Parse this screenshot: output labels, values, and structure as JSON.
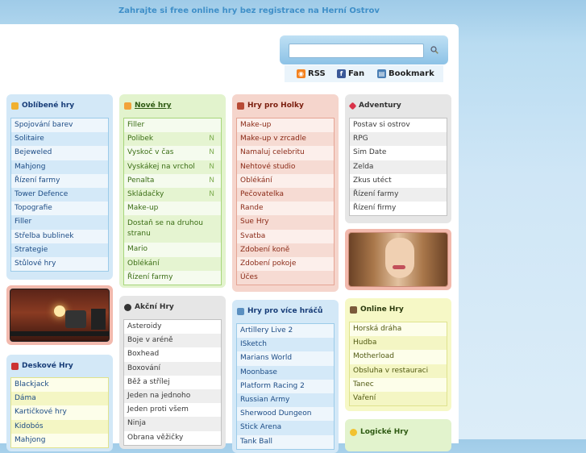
{
  "header": {
    "tagline": "Zahrajte si free online hry bez registrace na Herní Ostrov"
  },
  "search": {
    "placeholder": "",
    "button_icon": "magnifier-icon"
  },
  "links": [
    {
      "label": "RSS",
      "icon": "rss-icon",
      "color": "#f4821f"
    },
    {
      "label": "Fan",
      "icon": "facebook-icon",
      "color": "#3b5998"
    },
    {
      "label": "Bookmark",
      "icon": "bookmark-icon",
      "color": "#4a7fb5"
    }
  ],
  "categories": {
    "oblibene": {
      "title": "Oblíbené hry",
      "items": [
        "Spojování barev",
        "Solitaire",
        "Bejeweled",
        "Mahjong",
        "Řízení farmy",
        "Tower Defence",
        "Topografie",
        "Filler",
        "Střelba bublinek",
        "Strategie",
        "Stůlové hry"
      ]
    },
    "nove": {
      "title": "Nové hry",
      "items": [
        {
          "label": "Filler",
          "badge": ""
        },
        {
          "label": "Polibek",
          "badge": "N"
        },
        {
          "label": "Vyskoč v čas",
          "badge": "N"
        },
        {
          "label": "Vyskákej na vrchol",
          "badge": "N"
        },
        {
          "label": "Penalta",
          "badge": "N"
        },
        {
          "label": "Skládačky",
          "badge": "N"
        },
        {
          "label": "Make-up",
          "badge": ""
        },
        {
          "label": "Dostaň se na druhou stranu",
          "badge": ""
        },
        {
          "label": "Mario",
          "badge": ""
        },
        {
          "label": "Oblékání",
          "badge": ""
        },
        {
          "label": "Řízení farmy",
          "badge": ""
        }
      ]
    },
    "holky": {
      "title": "Hry pro Holky",
      "items": [
        "Make-up",
        "Make-up v zrcadle",
        "Namaluj celebritu",
        "Nehtové studio",
        "Oblékání",
        "Pečovatelka",
        "Rande",
        "Sue Hry",
        "Svatba",
        "Zdobení koně",
        "Zdobení pokoje",
        "Účes"
      ]
    },
    "adventury": {
      "title": "Adventury",
      "items": [
        "Postav si ostrov",
        "RPG",
        "Sim Date",
        "Zelda",
        "Zkus utéct",
        "Řízení farmy",
        "Řízení firmy"
      ]
    },
    "deskove": {
      "title": "Deskové Hry",
      "items": [
        "Blackjack",
        "Dáma",
        "Kartičkové hry",
        "Kidobós",
        "Mahjong"
      ]
    },
    "akcni": {
      "title": "Akční Hry",
      "items": [
        "Asteroidy",
        "Boje v aréně",
        "Boxhead",
        "Boxování",
        "Běž a střílej",
        "Jeden na jednoho",
        "Jeden proti všem",
        "Ninja",
        "Obrana věžičky"
      ]
    },
    "vice": {
      "title": "Hry pro více hráčů",
      "items": [
        "Artillery Live 2",
        "ISketch",
        "Marians World",
        "Moonbase",
        "Platform Racing 2",
        "Russian Army",
        "Sherwood Dungeon",
        "Stick Arena",
        "Tank Ball"
      ]
    },
    "online": {
      "title": "Online Hry",
      "items": [
        "Horská dráha",
        "Hudba",
        "Motherload",
        "Obsluha v restauraci",
        "Tanec",
        "Vaření"
      ]
    },
    "logicke": {
      "title": "Logické Hry"
    }
  }
}
